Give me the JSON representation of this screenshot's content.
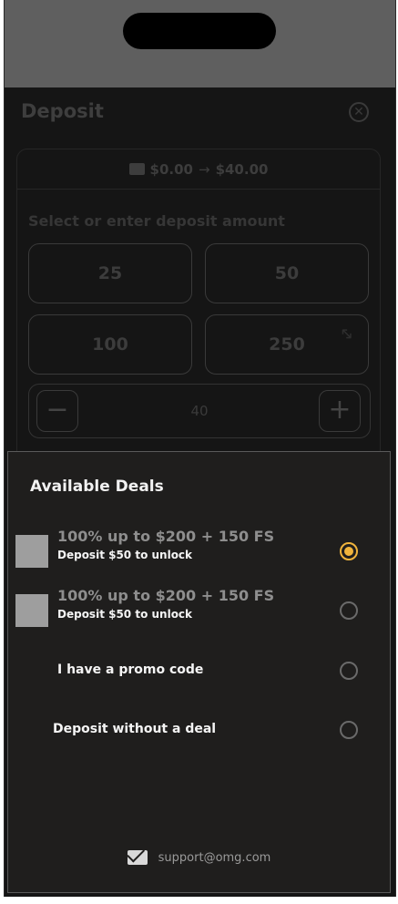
{
  "header": {
    "title": "Deposit"
  },
  "balance": {
    "from": "$0.00",
    "to": "$40.00"
  },
  "amount_section": {
    "prompt": "Select or enter deposit amount",
    "presets": [
      "25",
      "50",
      "100",
      "250"
    ],
    "stepper_value": "40"
  },
  "deals_sheet": {
    "title": "Available Deals",
    "deals": [
      {
        "title": "100% up to $200 + 150 FS",
        "subtitle": "Deposit $50 to unlock",
        "selected": true
      },
      {
        "title": "100% up to $200 + 150 FS",
        "subtitle": "Deposit $50 to unlock",
        "selected": false
      }
    ],
    "promo_label": "I have a promo code",
    "no_deal_label": "Deposit without a deal",
    "support_email": "support@omg.com"
  },
  "colors": {
    "accent": "#f0b43c",
    "sheet_bg": "#1f1e1d",
    "thumb": "#9e9e9e"
  }
}
